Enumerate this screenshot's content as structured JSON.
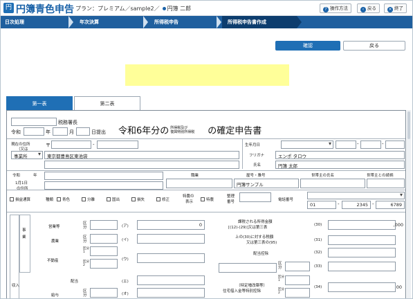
{
  "app": {
    "title": "円簿青色申告",
    "logo": "円",
    "plan": "プラン：プレミアム／sample2／",
    "user": "円簿 二郎",
    "buttons": {
      "help": "操作方法",
      "back": "戻る",
      "end": "終了"
    }
  },
  "steps": [
    "日次処理",
    "年次決算",
    "所得税申告",
    "所得税申告書作成"
  ],
  "actions": {
    "confirm": "確認",
    "return": "戻る"
  },
  "tabs": [
    "第一表",
    "第二表"
  ],
  "form": {
    "tax_office": "税務署長",
    "era": "令和",
    "year_label": "年",
    "month_label": "月",
    "day_label": "日提出",
    "title_pre": "令和6年分の",
    "title_small1": "所得税及び",
    "title_small2": "復興特別所得税",
    "title_post": "の確定申告書",
    "addr_label1": "現在の住所",
    "addr_label2": "（又は",
    "addr_select": "事業所",
    "postal_mark": "〒",
    "postal_dash": "-",
    "address": "東京都豊島区東池袋",
    "birth_label": "生年月日",
    "furigana_label": "フリガナ",
    "furigana": "エンポ タロウ",
    "name_label": "氏名",
    "name": "円簿 太郎",
    "jan1_era": "令和",
    "jan1_year": "年",
    "jan1_label1": "1月1日",
    "jan1_label2": "の住所",
    "col_job": "職業",
    "col_shop": "屋号・雅号",
    "col_head": "世帯主の氏名",
    "col_rel": "世帯主との続柄",
    "shop": "円簿サンプル",
    "cb_loss": "損益通算",
    "cb_kind": "種類",
    "cb_blue": "青色",
    "cb_split": "分離",
    "cb_nation": "国出",
    "cb_loss2": "損失",
    "cb_fix": "修正",
    "special_label1": "特農の",
    "special_label2": "表示",
    "cb_special": "特農",
    "ref_label1": "整理",
    "ref_label2": "番号",
    "phone_label": "電話番号",
    "phone1": "01",
    "phone2": "2345",
    "phone3": "6789",
    "side_income": "収入",
    "side_biz1": "事",
    "side_biz2": "業",
    "sections": {
      "rows": [
        {
          "label": "営業等",
          "kubun": "区分",
          "code": "(ア)",
          "value": "0"
        },
        {
          "label": "農業",
          "kubun": "区分",
          "code": "(イ)",
          "value": ""
        },
        {
          "label": "不動産",
          "code": "(ウ)",
          "value": "",
          "sub1": "区分 1",
          "sub2": "区分 2"
        },
        {
          "label": "配当",
          "code": "(エ)",
          "value": ""
        },
        {
          "label": "給与",
          "kubun": "区分",
          "code": "(オ)",
          "value": ""
        }
      ]
    },
    "right": [
      {
        "label1": "課税される所得金額",
        "label2": "[(12)-(29)]又は第三表",
        "code": "(30)",
        "value": ",000"
      },
      {
        "label1": "上の(30)に対する税額",
        "label2": "又は第三表の(95)",
        "code": "(31)",
        "value": ""
      },
      {
        "label1": "配当控除",
        "label2": "",
        "code": "(32)",
        "value": ""
      },
      {
        "label1": "",
        "label2": "",
        "code": "(33)",
        "kubun": "区分",
        "value": ""
      },
      {
        "label1": "（特定増改築等）",
        "label2": "住宅借入金等特別控除",
        "code": "(34)",
        "value": "00",
        "sub1": "区分 1",
        "sub2": "区分 2"
      }
    ]
  }
}
